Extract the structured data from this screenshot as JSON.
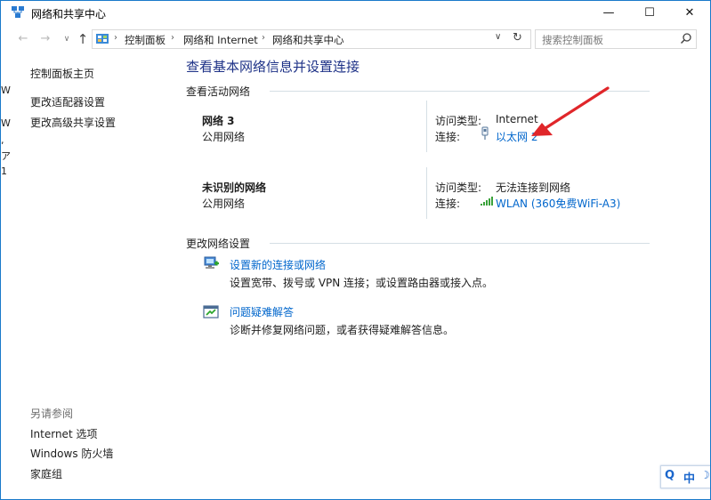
{
  "window": {
    "title": "网络和共享中心",
    "controls": {
      "minimize": "—",
      "maximize": "☐",
      "close": "✕"
    }
  },
  "nav": {
    "back": "←",
    "forward": "→",
    "recent": "∨",
    "up": "↑",
    "breadcrumbs": [
      "控制面板",
      "网络和 Internet",
      "网络和共享中心"
    ],
    "search_placeholder": "搜索控制面板"
  },
  "sidebar": {
    "links": [
      "控制面板主页",
      "更改适配器设置",
      "更改高级共享设置"
    ],
    "see_also_heading": "另请参阅",
    "see_also": [
      "Internet 选项",
      "Windows 防火墙",
      "家庭组"
    ]
  },
  "main": {
    "title": "查看基本网络信息并设置连接",
    "active_networks_heading": "查看活动网络",
    "networks": [
      {
        "name": "网络  3",
        "category": "公用网络",
        "access_label": "访问类型:",
        "access_value": "Internet",
        "connection_label": "连接:",
        "connection_value": "以太网 2",
        "connection_icon": "ethernet-icon"
      },
      {
        "name": "未识别的网络",
        "category": "公用网络",
        "access_label": "访问类型:",
        "access_value": "无法连接到网络",
        "connection_label": "连接:",
        "connection_value": "WLAN (360免费WiFi-A3)",
        "connection_icon": "wifi-signal-icon"
      }
    ],
    "change_settings_heading": "更改网络设置",
    "tasks": [
      {
        "link": "设置新的连接或网络",
        "description": "设置宽带、拨号或 VPN 连接；或设置路由器或接入点。",
        "icon": "new-connection-icon"
      },
      {
        "link": "问题疑难解答",
        "description": "诊断并修复网络问题，或者获得疑难解答信息。",
        "icon": "troubleshoot-icon"
      }
    ]
  },
  "ime": {
    "search": "Q",
    "lang": "中",
    "mode": "☽"
  },
  "background_edge_glyphs": [
    "W",
    "W",
    ",",
    "ア",
    "1"
  ],
  "colors": {
    "link": "#0066cc",
    "page_title": "#1e3287",
    "annotation_arrow": "#e0262a",
    "window_border": "#1979ca"
  }
}
